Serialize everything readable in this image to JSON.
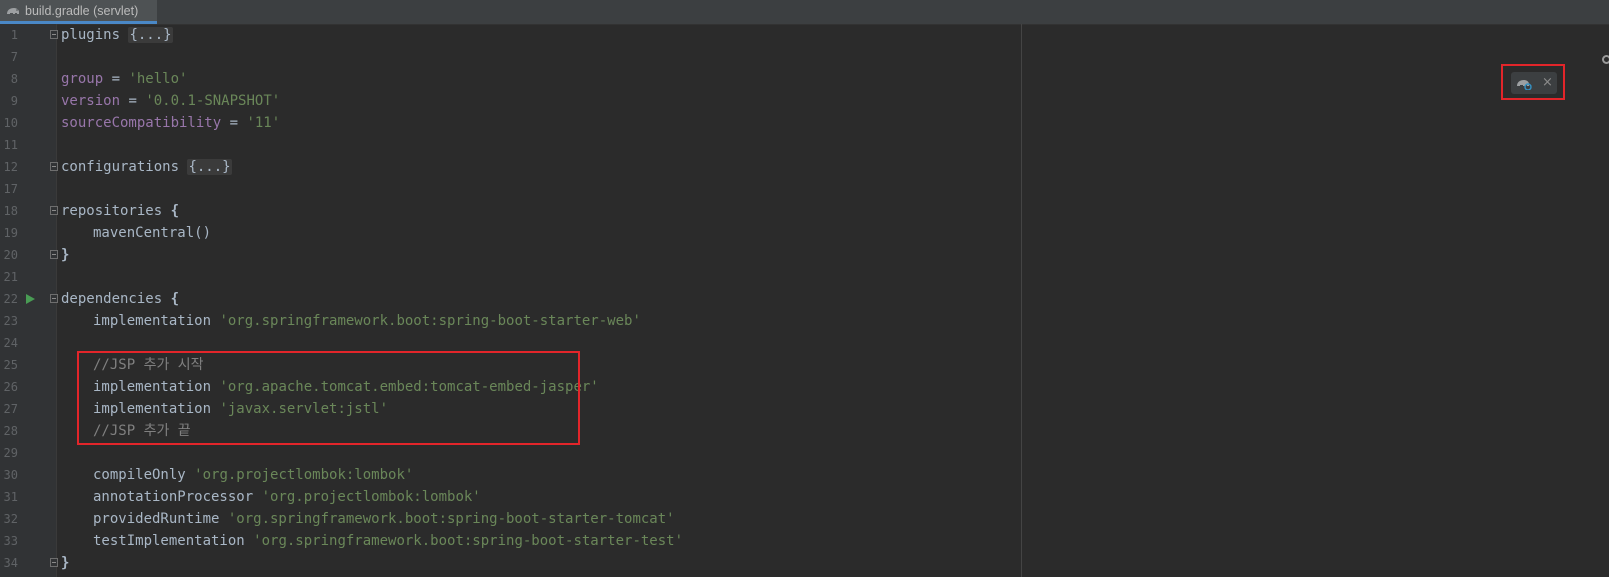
{
  "tab": {
    "label": "build.gradle (servlet)",
    "icon": "gradle-elephant-icon"
  },
  "lines": [
    {
      "num": "1"
    },
    {
      "num": "7"
    },
    {
      "num": "8"
    },
    {
      "num": "9"
    },
    {
      "num": "10"
    },
    {
      "num": "11"
    },
    {
      "num": "12"
    },
    {
      "num": "17"
    },
    {
      "num": "18"
    },
    {
      "num": "19"
    },
    {
      "num": "20"
    },
    {
      "num": "21"
    },
    {
      "num": "22"
    },
    {
      "num": "23"
    },
    {
      "num": "24"
    },
    {
      "num": "25"
    },
    {
      "num": "26"
    },
    {
      "num": "27"
    },
    {
      "num": "28"
    },
    {
      "num": "29"
    },
    {
      "num": "30"
    },
    {
      "num": "31"
    },
    {
      "num": "32"
    },
    {
      "num": "33"
    },
    {
      "num": "34"
    }
  ],
  "code": {
    "plugins_kw": "plugins ",
    "plugins_fold": "{...}",
    "group_prop": "group",
    "group_eq": " = ",
    "group_val": "'hello'",
    "version_prop": "version",
    "version_eq": " = ",
    "version_val": "'0.0.1-SNAPSHOT'",
    "sc_prop": "sourceCompatibility",
    "sc_eq": " = ",
    "sc_val": "'11'",
    "config_kw": "configurations ",
    "config_fold": "{...}",
    "repos_kw": "repositories ",
    "open_brace": "{",
    "maven": "mavenCentral()",
    "close_brace": "}",
    "deps_kw": "dependencies ",
    "impl1": "implementation ",
    "impl1_val": "'org.springframework.boot:spring-boot-starter-web'",
    "cmt_start": "//JSP 추가 시작",
    "impl2": "implementation ",
    "impl2_val": "'org.apache.tomcat.embed:tomcat-embed-jasper'",
    "impl3": "implementation ",
    "impl3_val": "'javax.servlet:jstl'",
    "cmt_end": "//JSP 추가 끝",
    "co": "compileOnly ",
    "co_val": "'org.projectlombok:lombok'",
    "ap": "annotationProcessor ",
    "ap_val": "'org.projectlombok:lombok'",
    "pr": "providedRuntime ",
    "pr_val": "'org.springframework.boot:spring-boot-starter-tomcat'",
    "ti": "testImplementation ",
    "ti_val": "'org.springframework.boot:spring-boot-starter-test'"
  },
  "popup": {
    "close_label": "×",
    "icon": "gradle-reload-icon"
  },
  "colors": {
    "background": "#2b2b2b",
    "keyword_property": "#9876aa",
    "string": "#6a8759",
    "comment": "#808080",
    "highlight_border": "#e3252a"
  }
}
